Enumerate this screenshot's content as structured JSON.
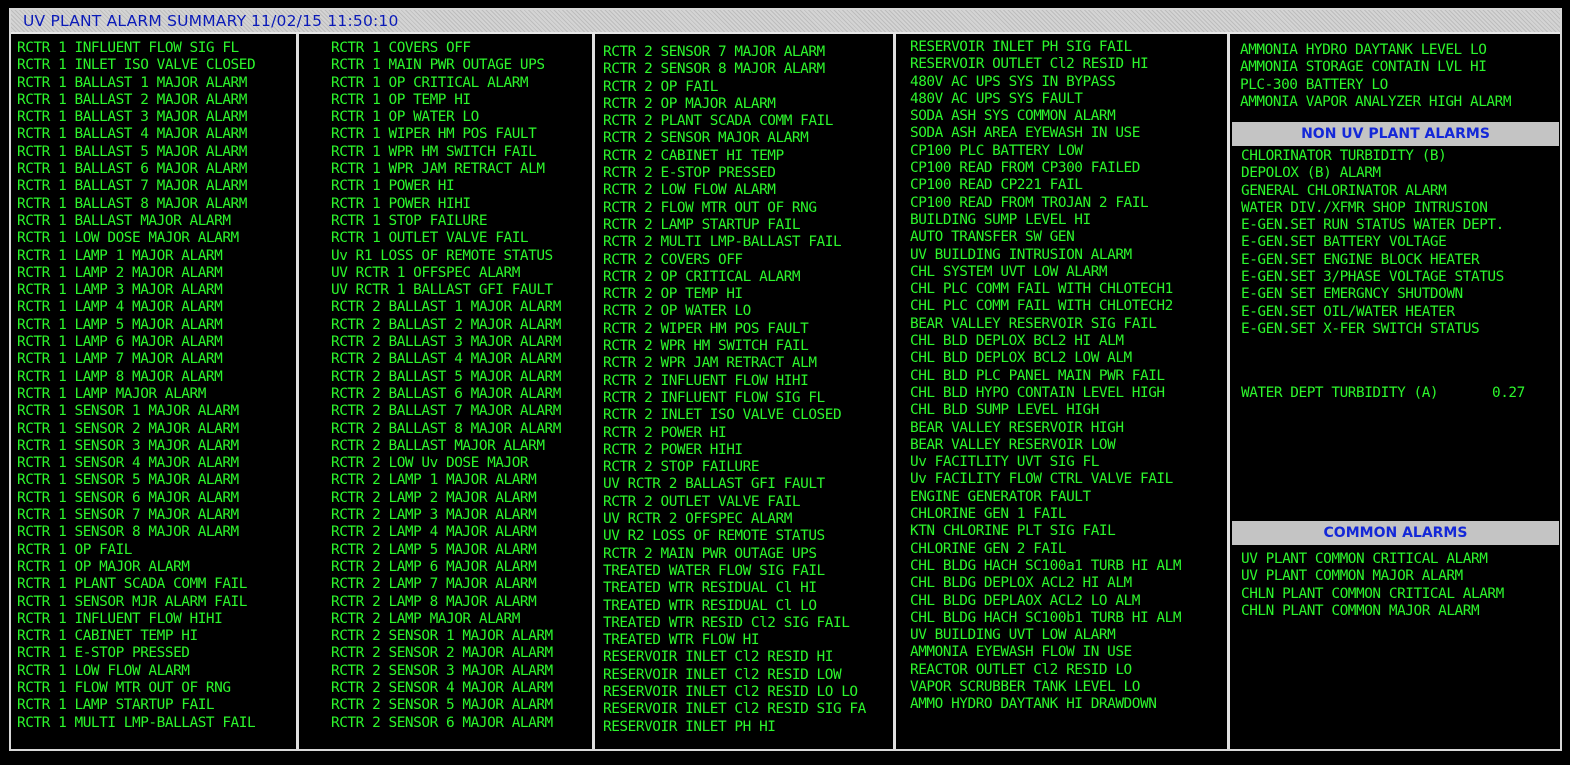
{
  "header": {
    "title": "UV PLANT ALARM SUMMARY",
    "datetime": "11/02/15 11:50:10"
  },
  "columns": [
    {
      "items": [
        "RCTR 1 INFLUENT FLOW SIG FL",
        "RCTR 1 INLET ISO VALVE CLOSED",
        "RCTR 1 BALLAST 1 MAJOR ALARM",
        "RCTR 1 BALLAST 2 MAJOR ALARM",
        "RCTR 1 BALLAST 3 MAJOR ALARM",
        "RCTR 1 BALLAST 4 MAJOR ALARM",
        "RCTR 1 BALLAST 5 MAJOR ALARM",
        "RCTR 1 BALLAST 6 MAJOR ALARM",
        "RCTR 1 BALLAST 7 MAJOR ALARM",
        "RCTR 1 BALLAST 8 MAJOR ALARM",
        "RCTR 1 BALLAST MAJOR ALARM",
        "RCTR 1 LOW DOSE MAJOR ALARM",
        "RCTR 1 LAMP 1 MAJOR ALARM",
        "RCTR 1 LAMP 2 MAJOR ALARM",
        "RCTR 1 LAMP 3 MAJOR ALARM",
        "RCTR 1 LAMP 4 MAJOR ALARM",
        "RCTR 1 LAMP 5 MAJOR ALARM",
        "RCTR 1 LAMP 6 MAJOR ALARM",
        "RCTR 1 LAMP 7 MAJOR ALARM",
        "RCTR 1 LAMP 8 MAJOR ALARM",
        "RCTR 1 LAMP MAJOR ALARM",
        "RCTR 1 SENSOR 1 MAJOR ALARM",
        "RCTR 1 SENSOR 2 MAJOR ALARM",
        "RCTR 1 SENSOR 3 MAJOR ALARM",
        "RCTR 1 SENSOR 4 MAJOR ALARM",
        "RCTR 1 SENSOR 5 MAJOR ALARM",
        "RCTR 1 SENSOR 6 MAJOR ALARM",
        "RCTR 1 SENSOR 7 MAJOR ALARM",
        "RCTR 1 SENSOR 8 MAJOR ALARM",
        "RCTR 1 OP FAIL",
        "RCTR 1 OP MAJOR ALARM",
        "RCTR 1 PLANT SCADA COMM FAIL",
        "RCTR 1 SENSOR MJR ALARM FAIL",
        "RCTR 1 INFLUENT FLOW HIHI",
        "RCTR 1 CABINET TEMP HI",
        "RCTR 1 E-STOP PRESSED",
        "RCTR 1 LOW FLOW ALARM",
        "RCTR 1 FLOW MTR OUT OF RNG",
        "RCTR 1 LAMP STARTUP FAIL",
        "RCTR 1 MULTI LMP-BALLAST FAIL"
      ]
    },
    {
      "items": [
        "RCTR 1 COVERS OFF",
        "RCTR 1 MAIN PWR OUTAGE UPS",
        "RCTR 1 OP CRITICAL ALARM",
        "RCTR 1 OP TEMP HI",
        "RCTR 1 OP WATER LO",
        "RCTR 1 WIPER HM POS FAULT",
        "RCTR 1 WPR HM SWITCH FAIL",
        "RCTR 1 WPR JAM RETRACT ALM",
        "RCTR 1 POWER HI",
        "RCTR 1 POWER HIHI",
        "RCTR 1 STOP FAILURE",
        "RCTR 1 OUTLET VALVE FAIL",
        "Uv R1 LOSS OF REMOTE STATUS",
        "UV RCTR 1 OFFSPEC ALARM",
        "UV RCTR 1 BALLAST GFI FAULT",
        "RCTR 2 BALLAST 1 MAJOR ALARM",
        "RCTR 2 BALLAST 2 MAJOR ALARM",
        "RCTR 2 BALLAST 3 MAJOR ALARM",
        "RCTR 2 BALLAST 4 MAJOR ALARM",
        "RCTR 2 BALLAST 5 MAJOR ALARM",
        "RCTR 2 BALLAST 6 MAJOR ALARM",
        "RCTR 2 BALLAST 7 MAJOR ALARM",
        "RCTR 2 BALLAST 8 MAJOR ALARM",
        "RCTR 2 BALLAST MAJOR ALARM",
        "RCTR 2 LOW Uv DOSE MAJOR",
        "RCTR 2 LAMP 1 MAJOR ALARM",
        "RCTR 2 LAMP 2 MAJOR ALARM",
        "RCTR 2 LAMP 3 MAJOR ALARM",
        "RCTR 2 LAMP 4 MAJOR ALARM",
        "RCTR 2 LAMP 5 MAJOR ALARM",
        "RCTR 2 LAMP 6 MAJOR ALARM",
        "RCTR 2 LAMP 7 MAJOR ALARM",
        "RCTR 2 LAMP 8 MAJOR ALARM",
        "RCTR 2 LAMP MAJOR ALARM",
        "RCTR 2 SENSOR 1 MAJOR ALARM",
        "RCTR 2 SENSOR 2 MAJOR ALARM",
        "RCTR 2 SENSOR 3 MAJOR ALARM",
        "RCTR 2 SENSOR 4 MAJOR ALARM",
        "RCTR 2 SENSOR 5 MAJOR ALARM",
        "RCTR 2 SENSOR 6 MAJOR ALARM"
      ]
    },
    {
      "items": [
        "RCTR 2 SENSOR 7 MAJOR ALARM",
        "RCTR 2 SENSOR 8 MAJOR ALARM",
        "RCTR 2 OP FAIL",
        "RCTR 2 OP MAJOR ALARM",
        "RCTR 2 PLANT SCADA COMM FAIL",
        "RCTR 2 SENSOR MAJOR ALARM",
        "RCTR 2 CABINET HI TEMP",
        "RCTR 2 E-STOP PRESSED",
        "RCTR 2 LOW FLOW ALARM",
        "RCTR 2 FLOW MTR OUT OF RNG",
        "RCTR 2 LAMP STARTUP FAIL",
        "RCTR 2 MULTI LMP-BALLAST FAIL",
        "RCTR 2 COVERS OFF",
        "RCTR 2 OP CRITICAL ALARM",
        "RCTR 2 OP TEMP HI",
        "RCTR 2 OP WATER LO",
        "RCTR 2 WIPER HM POS FAULT",
        "RCTR 2 WPR HM SWITCH FAIL",
        "RCTR 2 WPR JAM RETRACT ALM",
        "RCTR 2 INFLUENT FLOW HIHI",
        "RCTR 2 INFLUENT FLOW SIG FL",
        "RCTR 2 INLET ISO VALVE CLOSED",
        "RCTR 2 POWER HI",
        "RCTR 2 POWER HIHI",
        "RCTR 2 STOP FAILURE",
        "UV RCTR 2 BALLAST GFI FAULT",
        "RCTR 2 OUTLET VALVE FAIL",
        "UV RCTR 2 OFFSPEC ALARM",
        "UV R2 LOSS OF REMOTE STATUS",
        "RCTR 2 MAIN PWR OUTAGE UPS",
        "TREATED WATER FLOW SIG FAIL",
        "TREATED WTR RESIDUAL Cl HI",
        "TREATED WTR RESIDUAL Cl LO",
        "TREATED WTR RESID Cl2 SIG FAIL",
        "TREATED WTR FLOW HI",
        "RESERVOIR INLET Cl2 RESID HI",
        "RESERVOIR INLET Cl2 RESID LOW",
        "RESERVOIR INLET Cl2 RESID LO LO",
        "RESERVOIR INLET Cl2 RESID SIG FA",
        "RESERVOIR INLET PH HI"
      ]
    },
    {
      "items": [
        "RESERVOIR INLET PH SIG FAIL",
        "RESERVOIR OUTLET Cl2 RESID HI",
        "480V AC UPS SYS IN BYPASS",
        "480V AC UPS SYS FAULT",
        "SODA ASH SYS COMMON ALARM",
        "SODA ASH AREA EYEWASH IN USE",
        "CP100 PLC BATTERY LOW",
        "CP100 READ FROM CP300 FAILED",
        "CP100 READ CP221 FAIL",
        "CP100 READ FROM TROJAN 2 FAIL",
        "BUILDING SUMP LEVEL HI",
        "AUTO TRANSFER SW GEN",
        "UV BUILDING INTRUSION ALARM",
        "CHL SYSTEM UVT LOW ALARM",
        "CHL PLC COMM FAIL WITH CHLOTECH1",
        "CHL PLC COMM FAIL WITH CHLOTECH2",
        "BEAR VALLEY RESERVOIR SIG FAIL",
        "CHL BLD DEPLOX BCL2 HI ALM",
        "CHL BLD DEPLOX BCL2 LOW ALM",
        "CHL BLD PLC PANEL MAIN PWR FAIL",
        "CHL BLD HYPO CONTAIN LEVEL HIGH",
        "CHL BLD SUMP LEVEL HIGH",
        "BEAR VALLEY RESERVOIR HIGH",
        "BEAR VALLEY RESERVOIR LOW",
        "Uv FACITLITY UVT SIG FL",
        "Uv FACILITY FLOW CTRL VALVE FAIL",
        "ENGINE GENERATOR FAULT",
        "CHLORINE GEN 1 FAIL",
        "KTN CHLORINE PLT SIG FAIL",
        "CHLORINE GEN 2 FAIL",
        "CHL BLDG HACH SC100a1 TURB HI ALM",
        "CHL BLDG DEPLOX ACL2 HI ALM",
        "CHL BLDG DEPLAOX ACL2 LO ALM",
        "CHL BLDG HACH SC100b1 TURB HI ALM",
        "UV BUILDING UVT LOW ALARM",
        "AMMONIA EYEWASH FLOW IN USE",
        "REACTOR OUTLET Cl2 RESID LO",
        "VAPOR SCRUBBER TANK LEVEL LO",
        "AMMO HYDRO DAYTANK HI DRAWDOWN"
      ]
    },
    {
      "top_items": [
        "AMMONIA HYDRO DAYTANK LEVEL LO",
        "AMMONIA STORAGE CONTAIN LVL HI",
        "PLC-300 BATTERY LO",
        "AMMONIA VAPOR ANALYZER HIGH ALARM"
      ],
      "non_uv_header": "NON UV PLANT ALARMS",
      "non_uv_items": [
        "CHLORINATOR TURBIDITY (B)",
        "DEPOLOX (B) ALARM",
        "GENERAL CHLORINATOR ALARM",
        "WATER DIV./XFMR SHOP INTRUSION",
        "E-GEN.SET RUN STATUS WATER DEPT.",
        "E-GEN.SET BATTERY VOLTAGE",
        "E-GEN.SET ENGINE BLOCK HEATER",
        "E-GEN.SET 3/PHASE VOLTAGE STATUS",
        "E-GEN SET EMERGNCY SHUTDOWN",
        "E-GEN.SET OIL/WATER HEATER",
        "E-GEN.SET X-FER SWITCH STATUS"
      ],
      "turbidity_label": "WATER DEPT TURBIDITY (A)",
      "turbidity_value": "0.27",
      "common_header": "COMMON ALARMS",
      "common_items": [
        "UV PLANT COMMON CRITICAL ALARM",
        "UV PLANT COMMON MAJOR ALARM",
        "CHLN PLANT COMMON CRITICAL ALARM",
        "CHLN PLANT COMMON MAJOR ALARM"
      ]
    }
  ],
  "colors": {
    "alarm_text": "#2cf62c",
    "header_text": "#0a1ab8",
    "background": "#000000"
  }
}
